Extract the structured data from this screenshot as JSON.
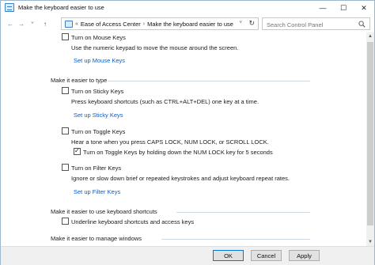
{
  "window": {
    "title": "Make the keyboard easier to use",
    "controls": {
      "minimize": "—",
      "maximize": "☐",
      "close": "✕"
    }
  },
  "address": {
    "back": "←",
    "forward": "→",
    "history": "˅",
    "up": "↑",
    "breadcrumb": [
      "Ease of Access Center",
      "Make the keyboard easier to use"
    ],
    "prefix_sep": "«",
    "sep": "›",
    "refresh": "↻",
    "search_placeholder": "Search Control Panel"
  },
  "sections": {
    "mouse_keys": {
      "checkbox_label": "Turn on Mouse Keys",
      "checked": false,
      "description": "Use the numeric keypad to move the mouse around the screen.",
      "setup_link": "Set up Mouse Keys"
    },
    "typing": {
      "heading": "Make it easier to type",
      "sticky_keys": {
        "checkbox_label": "Turn on Sticky Keys",
        "checked": false,
        "description": "Press keyboard shortcuts (such as CTRL+ALT+DEL) one key at a time.",
        "setup_link": "Set up Sticky Keys"
      },
      "toggle_keys": {
        "checkbox_label": "Turn on Toggle Keys",
        "checked": false,
        "description": "Hear a tone when you press CAPS LOCK, NUM LOCK, or SCROLL LOCK.",
        "sub_checkbox_label": "Turn on Toggle Keys by holding down the NUM LOCK key for 5 seconds",
        "sub_checked": true
      },
      "filter_keys": {
        "checkbox_label": "Turn on Filter Keys",
        "checked": false,
        "description": "Ignore or slow down brief or repeated keystrokes and adjust keyboard repeat rates.",
        "setup_link": "Set up Filter Keys"
      }
    },
    "shortcuts": {
      "heading": "Make it easier to use keyboard shortcuts",
      "underline": {
        "checkbox_label": "Underline keyboard shortcuts and access keys",
        "checked": false
      }
    },
    "windows": {
      "heading": "Make it easier to manage windows"
    }
  },
  "footer": {
    "ok": "OK",
    "cancel": "Cancel",
    "apply": "Apply"
  },
  "scrollbar": {
    "up": "▲",
    "down": "▼"
  }
}
